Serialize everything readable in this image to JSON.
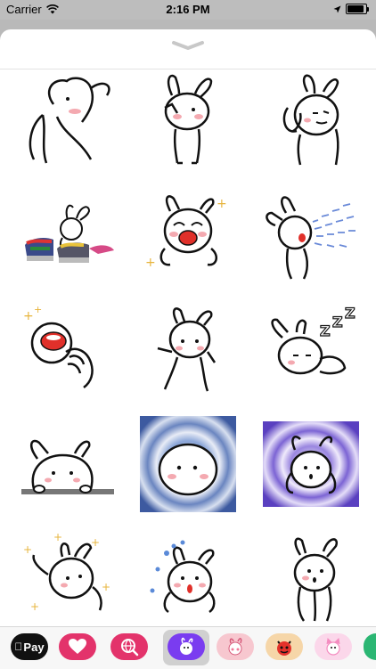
{
  "status_bar": {
    "carrier": "Carrier",
    "time": "2:16 PM",
    "battery_level": 0.9
  },
  "sheet": {
    "collapse_icon": "chevron-down-icon"
  },
  "stickers": [
    {
      "name": "bunny-hand-over-eye"
    },
    {
      "name": "bunny-wave-salute"
    },
    {
      "name": "bunny-headache"
    },
    {
      "name": "bunny-laundry-pile"
    },
    {
      "name": "bunny-laughing"
    },
    {
      "name": "bunny-sneezing"
    },
    {
      "name": "bunny-screaming-face"
    },
    {
      "name": "bunny-dancing"
    },
    {
      "name": "bunny-sleeping-zzz"
    },
    {
      "name": "bunny-peeking-over-ledge"
    },
    {
      "name": "bunny-spiral-blue"
    },
    {
      "name": "bunny-spiral-purple"
    },
    {
      "name": "bunny-sparkle-wave"
    },
    {
      "name": "bunny-surprised"
    },
    {
      "name": "bunny-standing"
    }
  ],
  "tray": {
    "apple_pay_label": "Pay",
    "items": [
      {
        "name": "apple-pay-app",
        "color": "#111111"
      },
      {
        "name": "digital-touch-app",
        "color": "#e3336b"
      },
      {
        "name": "search-images-app",
        "color": "#e3336b"
      },
      {
        "name": "bunny-sticker-pack-app",
        "color": "#7a3cf0",
        "selected": true
      },
      {
        "name": "pink-bunny-sticker-app",
        "color": "#f27a9a"
      },
      {
        "name": "devil-emoji-sticker-app",
        "color": "#e4322b"
      },
      {
        "name": "pink-cat-sticker-app",
        "color": "#f48cc0"
      },
      {
        "name": "green-app",
        "color": "#2bb673"
      }
    ]
  }
}
